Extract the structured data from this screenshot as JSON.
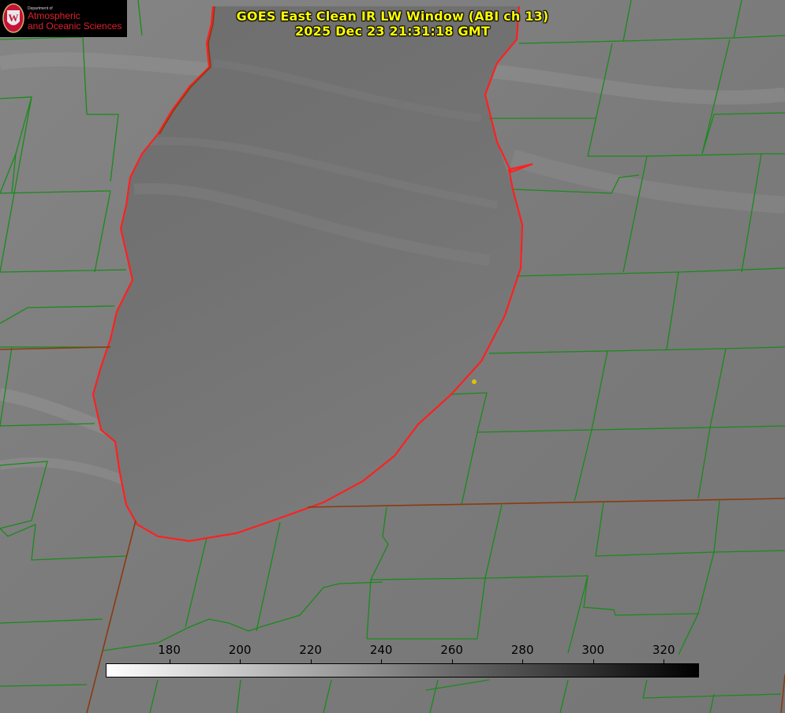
{
  "title": {
    "line1": "GOES East Clean IR LW Window (ABI ch 13)",
    "line2": "2025 Dec 23 21:31:18 GMT"
  },
  "logo": {
    "dept": "Department of",
    "line1": "Atmospheric",
    "line2": "and Oceanic Sciences",
    "seal_letter": "W"
  },
  "colorbar": {
    "min": 162,
    "max": 330,
    "ticks": [
      "180",
      "200",
      "220",
      "240",
      "260",
      "280",
      "300",
      "320"
    ],
    "tick_values": [
      180,
      200,
      220,
      240,
      260,
      280,
      300,
      320
    ],
    "color_low": "#ffffff",
    "color_high": "#000000"
  },
  "colors": {
    "county_lines": "#1a8a1a",
    "lake_outline": "#ff2020",
    "state_lines": "#8b3a10",
    "marker": "#e0c000",
    "title": "#ffff00"
  },
  "icons": [
    "uw-seal-icon",
    "location-marker-icon"
  ]
}
